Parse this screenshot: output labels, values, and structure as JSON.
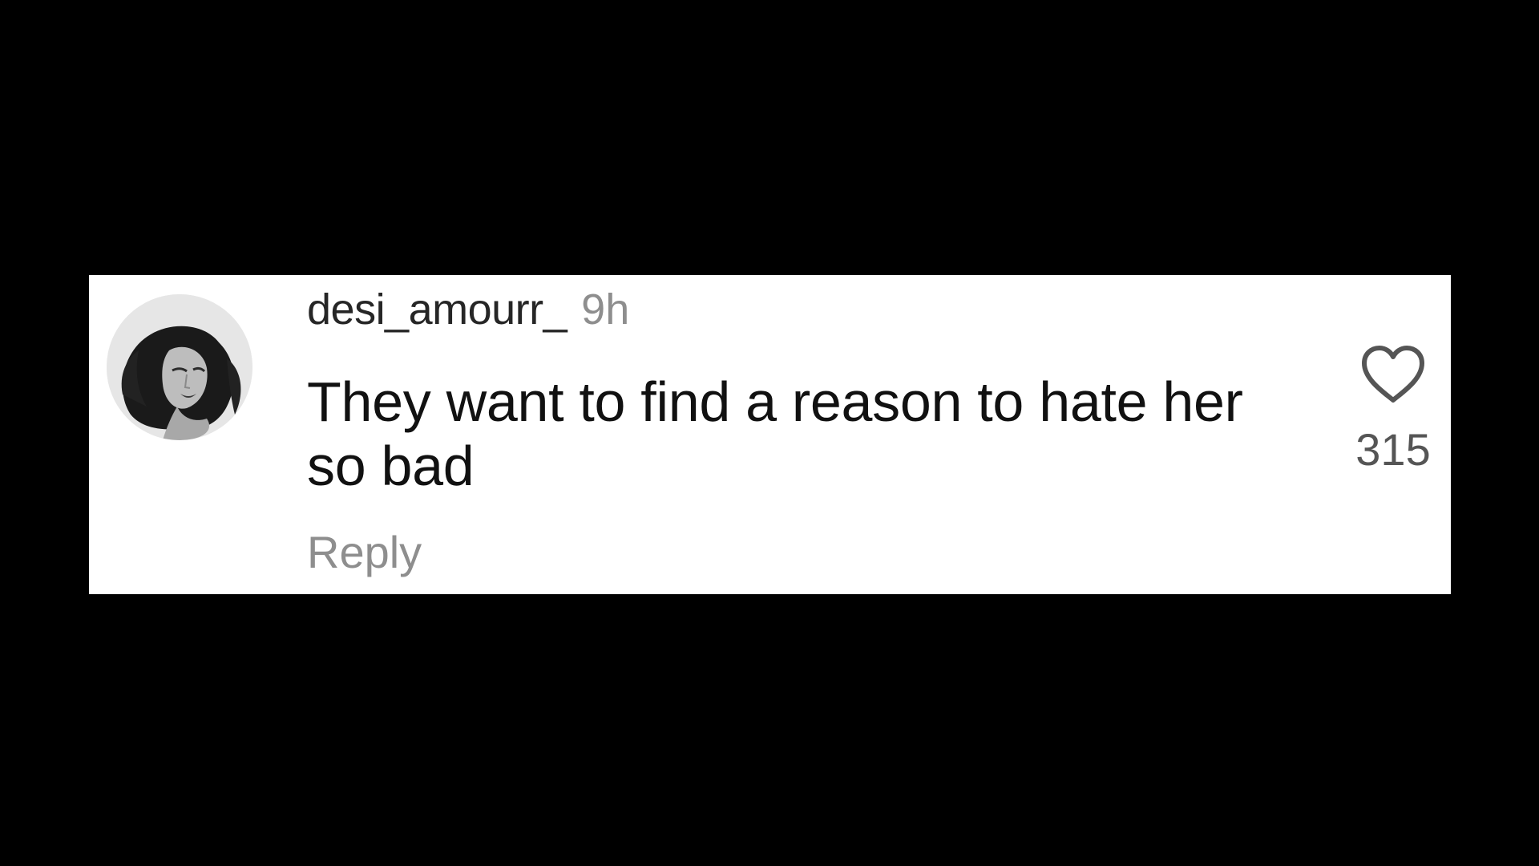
{
  "comment": {
    "username": "desi_amourr_",
    "timestamp": "9h",
    "text": "They want to find a reason to hate her so bad",
    "reply_label": "Reply",
    "like_count": "315",
    "avatar_icon": "profile-photo-icon",
    "like_icon": "heart-outline-icon"
  },
  "colors": {
    "background": "#000000",
    "card": "#ffffff",
    "username": "#262626",
    "muted": "#8e8e8e",
    "text": "#111111"
  }
}
